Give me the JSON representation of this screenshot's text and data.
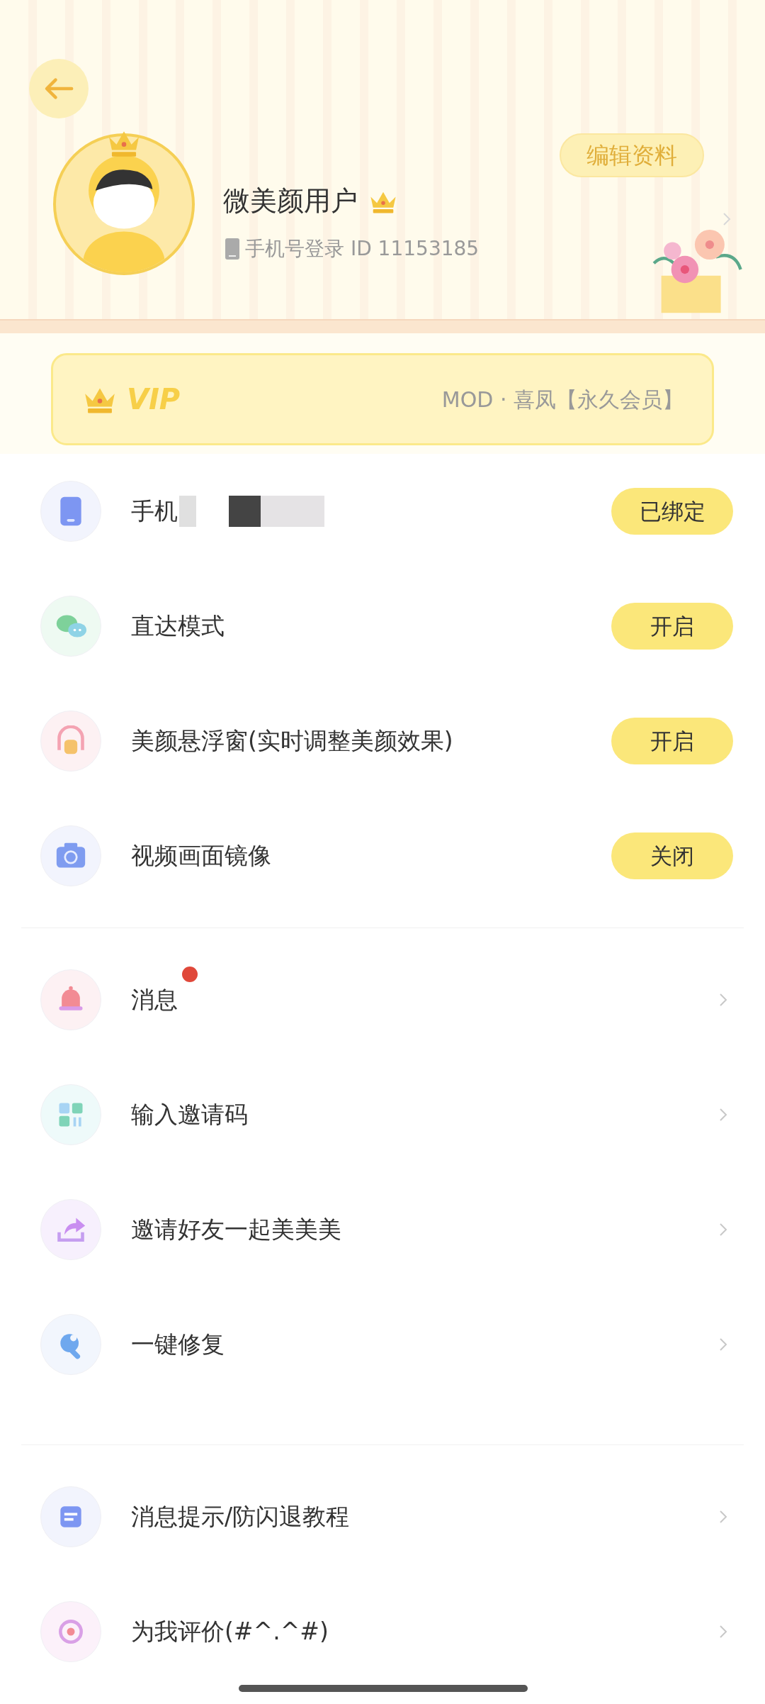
{
  "profile": {
    "name": "微美颜用户",
    "login_info": "手机号登录 ID 11153185",
    "edit_button": "编辑资料"
  },
  "vip": {
    "badge": "VIP",
    "plan": "MOD · 喜凤【永久会员】"
  },
  "sections": [
    {
      "items": [
        {
          "kind": "action",
          "label": "手机",
          "button": "已绑定",
          "redacted": true
        },
        {
          "kind": "action",
          "label": "直达模式",
          "button": "开启"
        },
        {
          "kind": "action",
          "label": "美颜悬浮窗(实时调整美颜效果)",
          "button": "开启"
        },
        {
          "kind": "action",
          "label": "视频画面镜像",
          "button": "关闭"
        }
      ]
    },
    {
      "items": [
        {
          "kind": "link",
          "label": "消息",
          "unread": true
        },
        {
          "kind": "link",
          "label": "输入邀请码"
        },
        {
          "kind": "link",
          "label": "邀请好友一起美美美"
        },
        {
          "kind": "link",
          "label": "一键修复"
        }
      ]
    },
    {
      "items": [
        {
          "kind": "link",
          "label": "消息提示/防闪退教程"
        },
        {
          "kind": "link",
          "label": "为我评价(#^.^#)"
        }
      ]
    }
  ]
}
